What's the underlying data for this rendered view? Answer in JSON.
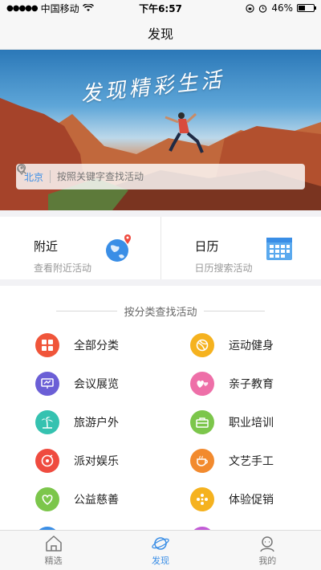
{
  "status_bar": {
    "carrier": "中国移动",
    "time": "下午6:57",
    "battery": "46%",
    "battery_level": 0.46
  },
  "nav": {
    "title": "发现"
  },
  "hero": {
    "slogan": "发现精彩生活",
    "city": "北京",
    "search_placeholder": "按照关键字查找活动"
  },
  "quick": [
    {
      "title": "附近",
      "subtitle": "查看附近活动",
      "icon": "globe-pin-icon"
    },
    {
      "title": "日历",
      "subtitle": "日历搜索活动",
      "icon": "calendar-icon"
    }
  ],
  "categories": {
    "header": "按分类查找活动",
    "items": [
      {
        "label": "全部分类",
        "icon": "grid-icon",
        "color": "#f0553a"
      },
      {
        "label": "运动健身",
        "icon": "ball-icon",
        "color": "#f5b21f"
      },
      {
        "label": "会议展览",
        "icon": "board-icon",
        "color": "#6b5fd6"
      },
      {
        "label": "亲子教育",
        "icon": "hearts-icon",
        "color": "#ee6fa8"
      },
      {
        "label": "旅游户外",
        "icon": "palm-icon",
        "color": "#35c2b0"
      },
      {
        "label": "职业培训",
        "icon": "briefcase-icon",
        "color": "#7cc64b"
      },
      {
        "label": "派对娱乐",
        "icon": "disc-icon",
        "color": "#ef4b3f"
      },
      {
        "label": "文艺手工",
        "icon": "cup-icon",
        "color": "#f28a2e"
      },
      {
        "label": "公益慈善",
        "icon": "heart-icon",
        "color": "#7cc64b"
      },
      {
        "label": "体验促销",
        "icon": "dots-icon",
        "color": "#f5b21f"
      }
    ]
  },
  "tabs": [
    {
      "label": "精选",
      "icon": "home-icon",
      "active": false
    },
    {
      "label": "发现",
      "icon": "planet-icon",
      "active": true
    },
    {
      "label": "我的",
      "icon": "user-icon",
      "active": false
    }
  ],
  "colors": {
    "accent": "#3a8ee6"
  }
}
